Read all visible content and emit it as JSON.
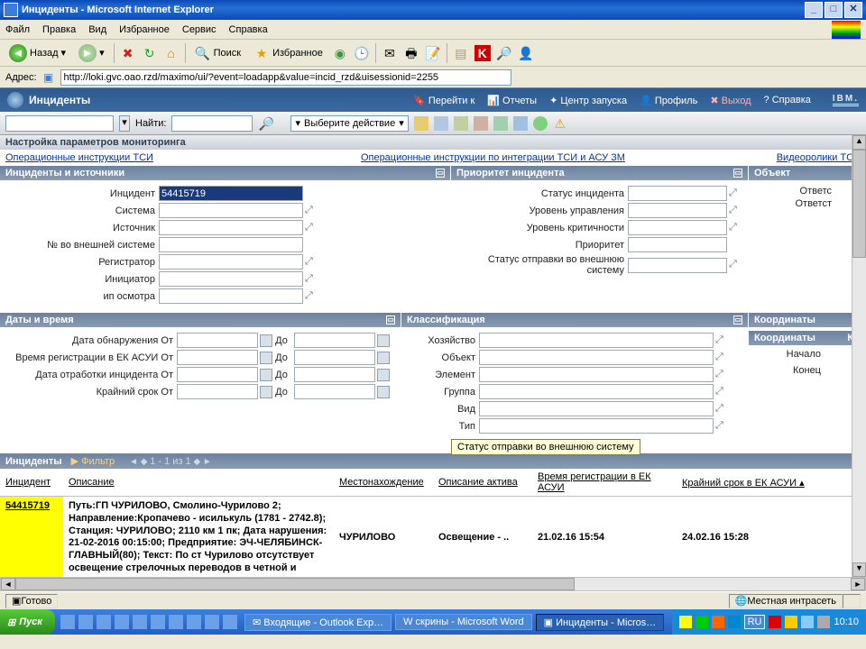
{
  "window": {
    "title": "Инциденты - Microsoft Internet Explorer"
  },
  "menu": {
    "file": "Файл",
    "edit": "Правка",
    "view": "Вид",
    "fav": "Избранное",
    "tools": "Сервис",
    "help": "Справка"
  },
  "tb": {
    "back": "Назад",
    "search": "Поиск",
    "favs": "Избранное"
  },
  "addr": {
    "label": "Адрес:",
    "url": "http://loki.gvc.oao.rzd/maximo/ui/?event=loadapp&value=incid_rzd&uisessionid=2255"
  },
  "app": {
    "title": "Инциденты",
    "nav": {
      "goto": "Перейти к",
      "reports": "Отчеты",
      "launch": "Центр запуска",
      "profile": "Профиль",
      "exit": "Выход",
      "help": "Справка"
    },
    "ibm": "IBM."
  },
  "action": {
    "find": "Найти:",
    "select": "Выберите действие"
  },
  "monitor": "Настройка параметров мониторинга",
  "instr": {
    "l1": "Операционные инструкции ТСИ",
    "l2": "Операционные инструкции по интеграции ТСИ и АСУ ЗМ",
    "l3": "Видеоролики ТСИ"
  },
  "sec": {
    "s1": "Инциденты и источники",
    "s2": "Приоритет инцидента",
    "s3": "Объект",
    "s4": "Даты и время",
    "s5": "Классификация",
    "s6": "Координаты"
  },
  "f1": {
    "incident": "Инцидент",
    "incident_val": "54415719",
    "system": "Система",
    "source": "Источник",
    "extno": "№ во внешней системе",
    "registrar": "Регистратор",
    "initiator": "Инициатор",
    "inspection": "ип осмотра"
  },
  "f2": {
    "status": "Статус инцидента",
    "ulevel": "Уровень управления",
    "clevel": "Уровень критичности",
    "priority": "Приоритет",
    "sendstatus": "Статус отправки во внешнюю систему"
  },
  "f3": {
    "resp": "Ответс",
    "acc": "Ответст"
  },
  "f4": {
    "detect": "Дата обнаружения От",
    "regtime": "Время регистрации в ЕК АСУИ От",
    "proc": "Дата отработки инцидента От",
    "deadline": "Крайний срок От",
    "to": "До"
  },
  "f5": {
    "econ": "Хозяйство",
    "obj": "Объект",
    "elem": "Элемент",
    "group": "Группа",
    "kind": "Вид",
    "type": "Тип"
  },
  "f6": {
    "hdr": "Координаты",
    "k": "Кл",
    "start": "Начало",
    "end": "Конец"
  },
  "tooltip": "Статус отправки во внешнюю систему",
  "results": {
    "title": "Инциденты",
    "filter": "Фильтр",
    "pager": "1 - 1 из 1",
    "cols": {
      "id": "Инцидент",
      "desc": "Описание",
      "loc": "Местонахождение",
      "asset": "Описание актива",
      "regtime": "Время регистрации в ЕК АСУИ",
      "deadline": "Крайний срок в ЕК АСУИ"
    },
    "rows": [
      {
        "id": "54415719",
        "desc": "Путь:ГП ЧУРИЛОВО, Смолино-Чурилово 2; Направление:Кропачево - исилькуль (1781 - 2742.8); Станция: ЧУРИЛОВО; 2110 км 1 пк; Дата нарушения: 21-02-2016 00:15:00; Предприятие: ЭЧ-ЧЕЛЯБИНСК-ГЛАВНЫЙ(80); Текст: По ст Чурилово отсутствует освещение стрелочных переводов в четной и",
        "loc": "ЧУРИЛОВО",
        "asset": "Освещение - ..",
        "regtime": "21.02.16 15:54",
        "deadline": "24.02.16 15:28"
      }
    ]
  },
  "status": {
    "ready": "Готово",
    "zone": "Местная интрасеть"
  },
  "taskbar": {
    "start": "Пуск",
    "tasks": [
      {
        "label": "Входящие - Outlook Exp…"
      },
      {
        "label": "скрины - Microsoft Word"
      },
      {
        "label": "Инциденты - Micros…"
      }
    ],
    "lang": "RU",
    "clock": "10:10"
  }
}
